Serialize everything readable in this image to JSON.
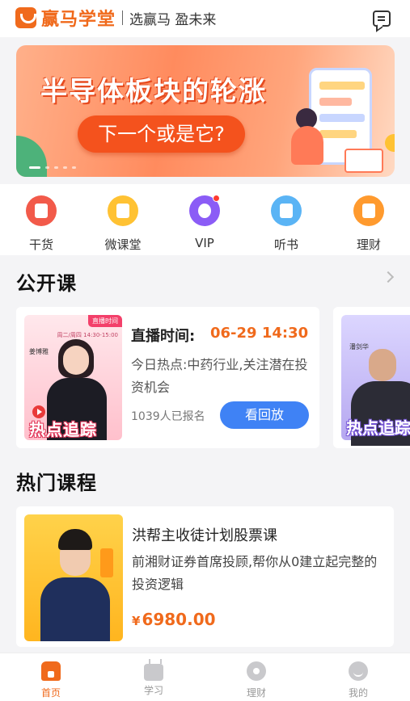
{
  "header": {
    "logo_text": "赢马学堂",
    "slogan": "选赢马 盈未来",
    "message_icon": "message-icon"
  },
  "banner": {
    "title": "半导体板块的轮涨",
    "subtitle": "下一个或是它?",
    "slide_count": 5,
    "active_slide": 1
  },
  "categories": [
    {
      "label": "干货",
      "icon": "document-icon",
      "color": "#f25a4a"
    },
    {
      "label": "微课堂",
      "icon": "tv-icon",
      "color": "#ffc233"
    },
    {
      "label": "VIP",
      "icon": "vip-icon",
      "color": "#8b5cf6",
      "badge": true
    },
    {
      "label": "听书",
      "icon": "book-icon",
      "color": "#5ab4f5"
    },
    {
      "label": "理财",
      "icon": "wallet-icon",
      "color": "#ff9a2e"
    }
  ],
  "public_courses": {
    "title": "公开课",
    "items": [
      {
        "thumb_tag": "直播时间",
        "thumb_teacher": "姜博雅",
        "thumb_schedule": "周二/周四 14:30-15:00",
        "thumb_banner": "热点追踪",
        "live_label": "直播时间:",
        "live_time": "06-29 14:30",
        "description": "今日热点:中药行业,关注潜在投资机会",
        "enroll_count": "1039人已报名",
        "button": "看回放"
      },
      {
        "thumb_teacher": "潘剑华",
        "thumb_banner": "热点追踪"
      }
    ]
  },
  "hot_courses": {
    "title": "热门课程",
    "items": [
      {
        "title": "洪帮主收徒计划股票课",
        "description": "前湘财证券首席投顾,帮你从0建立起完整的投资逻辑",
        "currency": "¥",
        "price": "6980.00"
      }
    ]
  },
  "tabbar": [
    {
      "label": "首页",
      "icon": "home-icon",
      "active": true
    },
    {
      "label": "学习",
      "icon": "tv-icon",
      "active": false
    },
    {
      "label": "理财",
      "icon": "finance-icon",
      "active": false
    },
    {
      "label": "我的",
      "icon": "profile-icon",
      "active": false
    }
  ],
  "colors": {
    "brand": "#f06a1c",
    "button_blue": "#3f82f5"
  }
}
